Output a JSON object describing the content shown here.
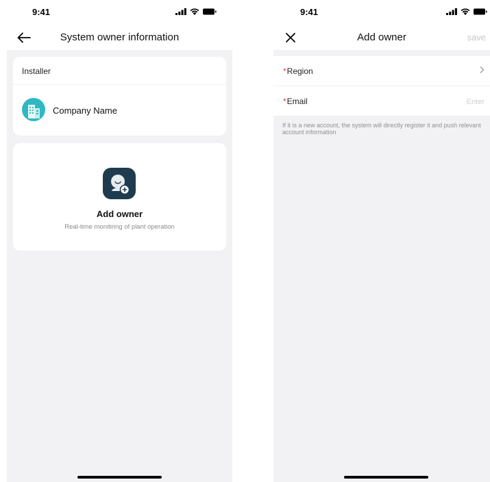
{
  "phone1": {
    "status_time": "9:41",
    "title": "System owner information",
    "installer_label": "Installer",
    "company_name": "Company Name",
    "add_owner_title": "Add owner",
    "add_owner_subtitle": "Real-time monitiring of plant operation"
  },
  "phone2": {
    "status_time": "9:41",
    "title": "Add owner",
    "save_label": "save",
    "region_label": "Region",
    "email_label": "Email",
    "email_placeholder": "Enter",
    "required_mark": "*",
    "hint_text": "If it is a new account, the system will directly register it and push relevant account information"
  },
  "icons": {
    "back": "arrow-left-icon",
    "close": "close-icon",
    "chevron": "chevron-right-icon",
    "owner": "add-user-icon",
    "company": "building-icon"
  },
  "colors": {
    "background": "#f2f2f4",
    "required": "#e53935",
    "company_logo": "#2fb8c2",
    "owner_icon": "#1f3b4f",
    "save_disabled": "#c8c8c8"
  }
}
